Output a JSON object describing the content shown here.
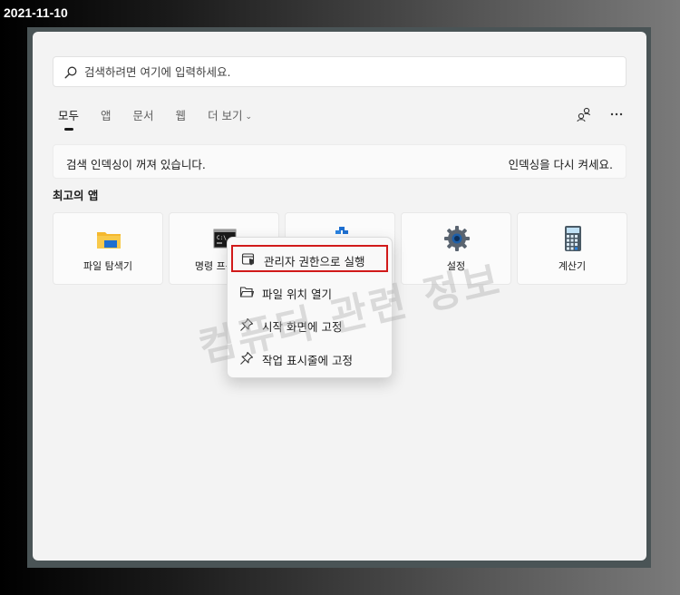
{
  "date_stamp": "2021-11-10",
  "search": {
    "placeholder": "검색하려면 여기에 입력하세요."
  },
  "tabs": [
    {
      "label": "모두",
      "active": true
    },
    {
      "label": "앱"
    },
    {
      "label": "문서"
    },
    {
      "label": "웹"
    },
    {
      "label": "더 보기"
    }
  ],
  "top_icons": [
    "account-switch-icon",
    "more-options-icon"
  ],
  "notice": {
    "text": "검색 인덱싱이 꺼져 있습니다.",
    "link": "인덱싱을 다시 켜세요."
  },
  "best_apps": {
    "title": "최고의 앱",
    "items": [
      {
        "label": "파일 탐색기",
        "icon": "folder-icon"
      },
      {
        "label": "명령 프롬프트",
        "icon": "terminal-icon"
      },
      {
        "label": "",
        "icon": "app-icon"
      },
      {
        "label": "설정",
        "icon": "gear-icon"
      },
      {
        "label": "계산기",
        "icon": "calculator-icon"
      }
    ]
  },
  "context_menu": {
    "items": [
      {
        "label": "관리자 권한으로 실행",
        "icon": "admin-shield-icon",
        "highlighted": true
      },
      {
        "label": "파일 위치 열기",
        "icon": "open-folder-icon"
      },
      {
        "label": "시작 화면에 고정",
        "icon": "pin-icon"
      },
      {
        "label": "작업 표시줄에 고정",
        "icon": "pin-icon"
      }
    ]
  },
  "watermark": "컴퓨터 관련 정보",
  "colors": {
    "highlight_border": "#d11a1a",
    "folder": "#f5b82e",
    "gear": "#1e5fa8",
    "terminal": "#1a1a1a"
  }
}
